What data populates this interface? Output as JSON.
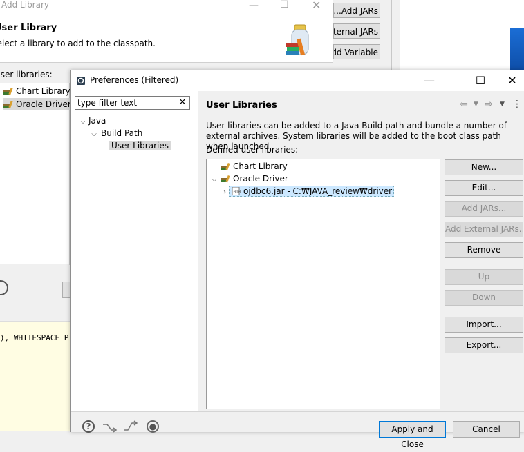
{
  "background_dialog": {
    "title": "Add Library",
    "heading": "User Library",
    "subtitle": "Select a library to add to the classpath.",
    "user_libraries_label": "User libraries:",
    "libraries": [
      "Chart Library",
      "Oracle Driver"
    ],
    "right_buttons": [
      "Add JARs...",
      "Add External JARs...",
      "Add Variable..."
    ]
  },
  "background_editor": {
    "code_line": "), WHITESPACE_P"
  },
  "prefs": {
    "title": "Preferences (Filtered)",
    "filter_placeholder": "type filter text",
    "filter_value": "type filter text",
    "tree": {
      "java": "Java",
      "build_path": "Build Path",
      "user_libraries": "User Libraries"
    },
    "page_title": "User Libraries",
    "description": "User libraries can be added to a Java Build path and bundle a number of external archives. System libraries will be added to the boot class path when launched.",
    "defined_label": "Defined user libraries:",
    "libraries": [
      {
        "name": "Chart Library"
      },
      {
        "name": "Oracle Driver"
      }
    ],
    "jar_entry": "ojdbc6.jar - C:₩JAVA_review₩driver",
    "buttons": {
      "new": "New...",
      "edit": "Edit...",
      "add_jars": "Add JARs...",
      "add_external_jars": "Add External JARs...",
      "remove": "Remove",
      "up": "Up",
      "down": "Down",
      "import": "Import...",
      "export": "Export..."
    },
    "apply_close": "Apply and Close",
    "cancel": "Cancel"
  }
}
